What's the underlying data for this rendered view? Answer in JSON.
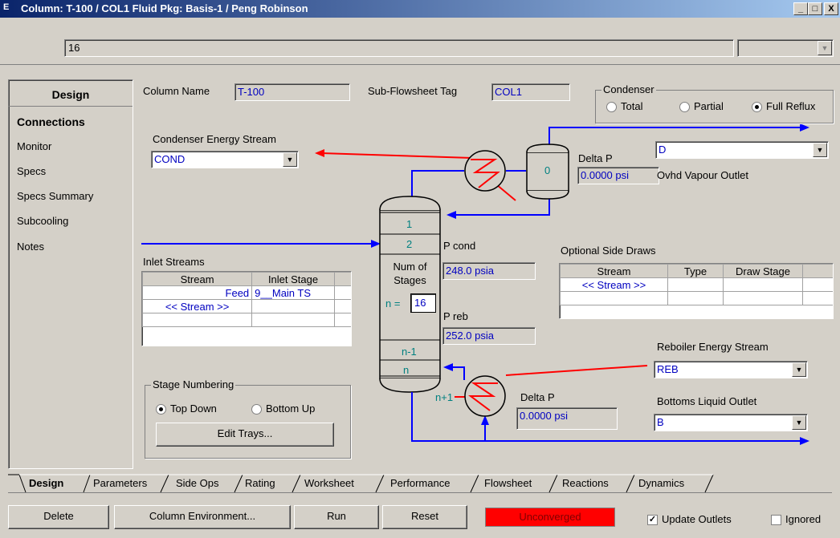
{
  "window": {
    "title": "Column: T-100 / COL1  Fluid Pkg: Basis-1 / Peng Robinson",
    "app_icon": "E",
    "min": "_",
    "max": "□",
    "close": "X"
  },
  "top_field": {
    "value": "16"
  },
  "left_nav": {
    "header": "Design",
    "items": [
      "Connections",
      "Monitor",
      "Specs",
      "Specs Summary",
      "Subcooling",
      "Notes"
    ]
  },
  "column_name": {
    "label": "Column Name",
    "value": "T-100"
  },
  "subflowsheet": {
    "label": "Sub-Flowsheet Tag",
    "value": "COL1"
  },
  "condenser": {
    "label": "Condenser",
    "options": [
      "Total",
      "Partial",
      "Full Reflux"
    ],
    "selected": "Full Reflux"
  },
  "condenser_energy": {
    "label": "Condenser Energy Stream",
    "value": "COND"
  },
  "ovhd": {
    "value": "D",
    "label": "Ovhd Vapour Outlet"
  },
  "delta_p_top": {
    "label": "Delta P",
    "value": "0.0000 psi"
  },
  "cond_stage": "0",
  "p_cond": {
    "label": "P cond",
    "value": "248.0 psia"
  },
  "p_reb": {
    "label": "P reb",
    "value": "252.0 psia"
  },
  "column": {
    "stage1": "1",
    "stage2": "2",
    "num_label": "Num of Stages",
    "n_eq": "n =",
    "n_value": "16",
    "stage_n1": "n-1",
    "stage_n": "n",
    "reb_stage": "n+1"
  },
  "inlet": {
    "label": "Inlet Streams",
    "headers": [
      "Stream",
      "Inlet Stage"
    ],
    "rows": [
      [
        "Feed",
        "9__Main TS"
      ],
      [
        "<< Stream >>",
        ""
      ],
      [
        "",
        ""
      ]
    ]
  },
  "side_draws": {
    "label": "Optional Side Draws",
    "headers": [
      "Stream",
      "Type",
      "Draw Stage"
    ],
    "rows": [
      [
        "<< Stream >>",
        "",
        ""
      ],
      [
        "",
        "",
        ""
      ]
    ]
  },
  "reboiler_energy": {
    "label": "Reboiler Energy Stream",
    "value": "REB"
  },
  "delta_p_bot": {
    "label": "Delta P",
    "value": "0.0000 psi"
  },
  "bottoms": {
    "label": "Bottoms Liquid Outlet",
    "value": "B"
  },
  "stage_numbering": {
    "label": "Stage Numbering",
    "options": [
      "Top Down",
      "Bottom Up"
    ],
    "selected": "Top Down",
    "edit": "Edit Trays..."
  },
  "tabs": [
    "Design",
    "Parameters",
    "Side Ops",
    "Rating",
    "Worksheet",
    "Performance",
    "Flowsheet",
    "Reactions",
    "Dynamics"
  ],
  "active_tab": "Design",
  "bottom": {
    "delete": "Delete",
    "col_env": "Column Environment...",
    "run": "Run",
    "reset": "Reset",
    "status": "Unconverged",
    "update": "Update Outlets",
    "ignored": "Ignored"
  },
  "colors": {
    "status_bg": "#ff0000",
    "stream_blue": "#0000ff",
    "energy_red": "#ff0000",
    "teal": "#008080",
    "field_text": "#0000c0"
  }
}
